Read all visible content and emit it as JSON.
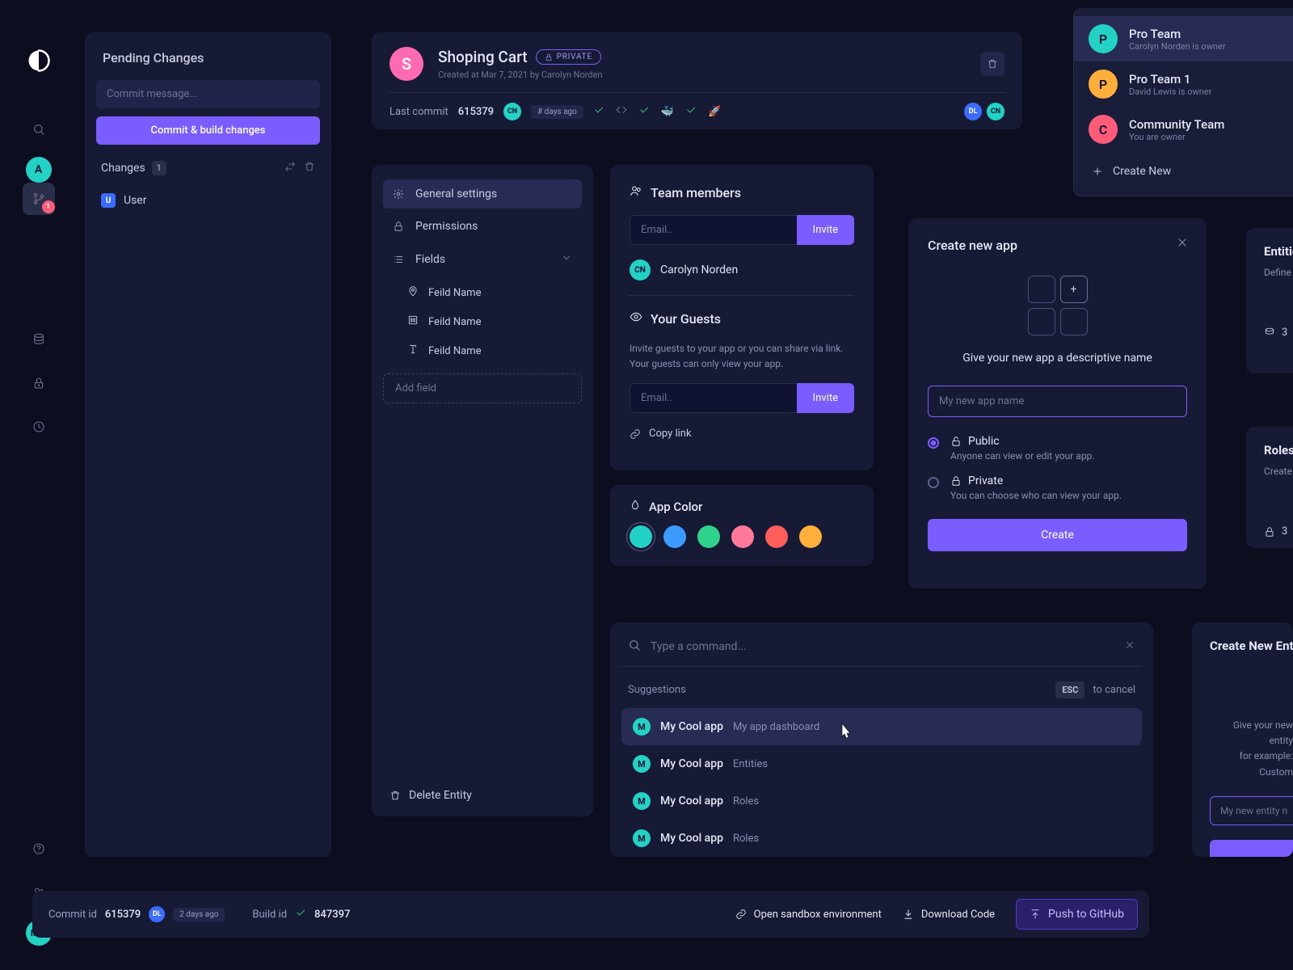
{
  "pending": {
    "title": "Pending Changes",
    "commit_placeholder": "Commit message...",
    "commit_btn": "Commit & build changes",
    "changes_label": "Changes",
    "changes_count": "1",
    "item_badge": "U",
    "item_name": "User"
  },
  "header": {
    "initial": "S",
    "title": "Shoping Cart",
    "pill": "PRIVATE",
    "meta": "Created at Mar 7, 2021 by Carolyn Norden",
    "last_commit_label": "Last commit",
    "last_commit_hash": "615379",
    "cn": "CN",
    "dl": "DL",
    "days": "# days ago"
  },
  "settings": {
    "general": "General settings",
    "permissions": "Permissions",
    "fields": "Fields",
    "field_items": [
      "Feild Name",
      "Feild Name",
      "Feild Name"
    ],
    "add_field": "Add field",
    "delete_entity": "Delete Entity"
  },
  "team": {
    "members_title": "Team members",
    "email_placeholder": "Email..",
    "invite": "Invite",
    "member_cn": "CN",
    "member_name": "Carolyn Norden",
    "guests_title": "Your Guests",
    "guests_desc": "Invite guests to your app or you can share via link. Your guests can only view your app.",
    "copy_link": "Copy link"
  },
  "appcolor": {
    "title": "App Color",
    "colors": [
      "#22d3c5",
      "#3b9bff",
      "#30d28b",
      "#ff7a9a",
      "#ff5c5c",
      "#ffb03b"
    ]
  },
  "createapp": {
    "title": "Create new app",
    "desc": "Give your new app a descriptive name",
    "name_placeholder": "My new app name",
    "public_title": "Public",
    "public_sub": "Anyone can view or edit your app.",
    "private_title": "Private",
    "private_sub": "You can choose who can view your app.",
    "create_btn": "Create"
  },
  "teams": {
    "items": [
      {
        "initial": "P",
        "bg": "#22d3c5",
        "name": "Pro Team",
        "sub": "Carolyn Norden is owner"
      },
      {
        "initial": "P",
        "bg": "#ffb03b",
        "name": "Pro Team  1",
        "sub": "David Lewis is owner"
      },
      {
        "initial": "C",
        "bg": "#ff5c7a",
        "name": "Community Team",
        "sub": "You are owner"
      }
    ],
    "create_new": "Create New"
  },
  "cmd": {
    "placeholder": "Type a command...",
    "suggestions": "Suggestions",
    "esc": "ESC",
    "to_cancel": "to cancel",
    "items": [
      {
        "name": "My Cool app",
        "sub": "My app dashboard"
      },
      {
        "name": "My Cool app",
        "sub": "Entities"
      },
      {
        "name": "My Cool app",
        "sub": "Roles"
      },
      {
        "name": "My Cool app",
        "sub": "Roles"
      }
    ]
  },
  "frag": {
    "entities": "Entities",
    "entities_sub": "Define entities fo",
    "count": "3",
    "roles": "Roles",
    "roles_sub": "Create roles for yo",
    "create_entity": "Create New Entity",
    "create_entity_desc1": "Give your new entity",
    "create_entity_desc2": "for example: Custom",
    "entity_placeholder": "My new entity name"
  },
  "footer": {
    "commit_label": "Commit id",
    "commit_val": "615379",
    "dl": "DL",
    "days": "2 days ago",
    "build_label": "Build id",
    "build_val": "847397",
    "sandbox": "Open sandbox environment",
    "download": "Download Code",
    "push": "Push to GitHub"
  },
  "rail": {
    "a": "A",
    "mm": "MM",
    "git_badge": "1"
  }
}
